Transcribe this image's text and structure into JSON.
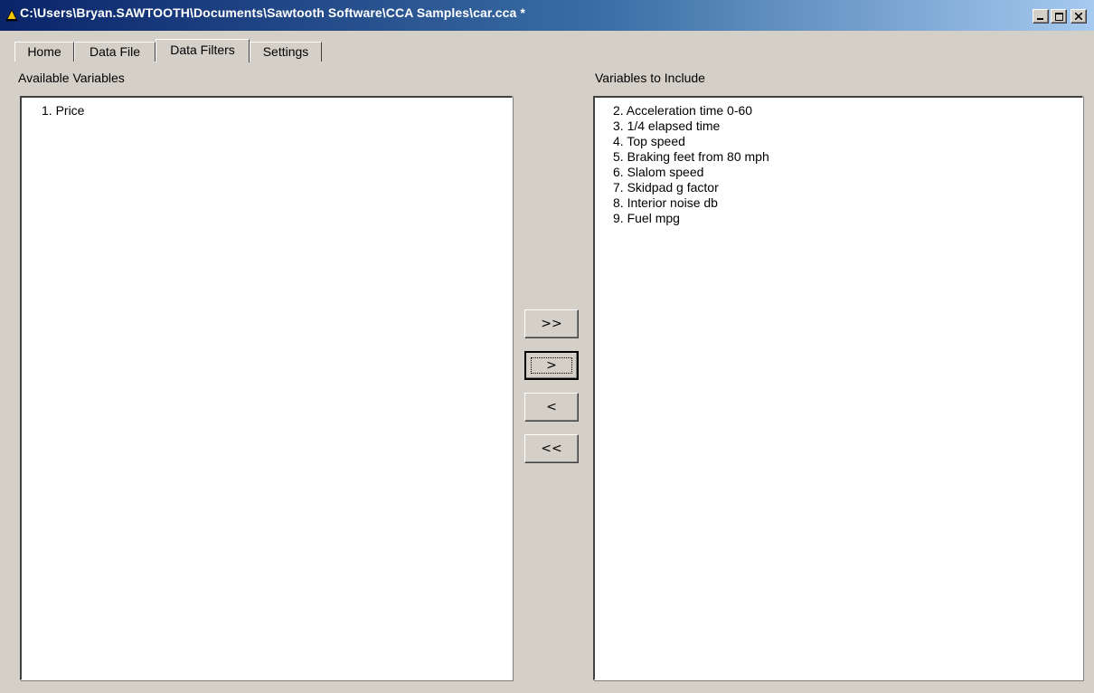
{
  "window": {
    "title": "C:\\Users\\Bryan.SAWTOOTH\\Documents\\Sawtooth Software\\CCA Samples\\car.cca *",
    "title_icon": "app-icon",
    "controls": [
      "minimize-icon",
      "maximize-icon",
      "close-icon"
    ]
  },
  "tabs": [
    {
      "label": "Home",
      "active": false
    },
    {
      "label": "Data File",
      "active": false
    },
    {
      "label": "Data Filters",
      "active": true
    },
    {
      "label": "Settings",
      "active": false
    }
  ],
  "available": {
    "label": "Available Variables",
    "items": [
      "1.  Price"
    ]
  },
  "included": {
    "label": "Variables to Include",
    "items": [
      "2.  Acceleration time 0-60",
      "3.  1/4 elapsed time",
      "4.  Top speed",
      "5.  Braking feet from 80 mph",
      "6.  Slalom speed",
      "7.  Skidpad g factor",
      "8.  Interior noise db",
      "9.  Fuel mpg"
    ]
  },
  "buttons": {
    "add_all": ">>",
    "add": ">",
    "remove": "<",
    "remove_all": "<<"
  },
  "colors": {
    "titlebar_start": "#0a246a",
    "titlebar_end": "#a6caf0",
    "face": "#d4d0c8",
    "list_bg": "#ffffff"
  }
}
